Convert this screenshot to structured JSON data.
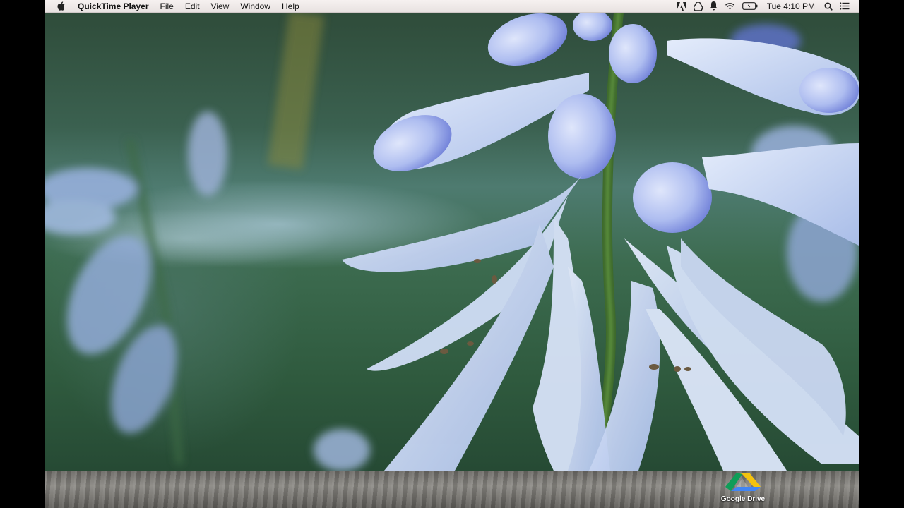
{
  "menubar": {
    "app_name": "QuickTime Player",
    "menus": [
      "File",
      "Edit",
      "View",
      "Window",
      "Help"
    ],
    "clock": "Tue 4:10 PM"
  },
  "desktop": {
    "drive_label": "Google Drive"
  },
  "colors": {
    "menubar_bg": "#f1ecea",
    "flower": "#b8c9ef",
    "foliage": "#3b6150"
  }
}
